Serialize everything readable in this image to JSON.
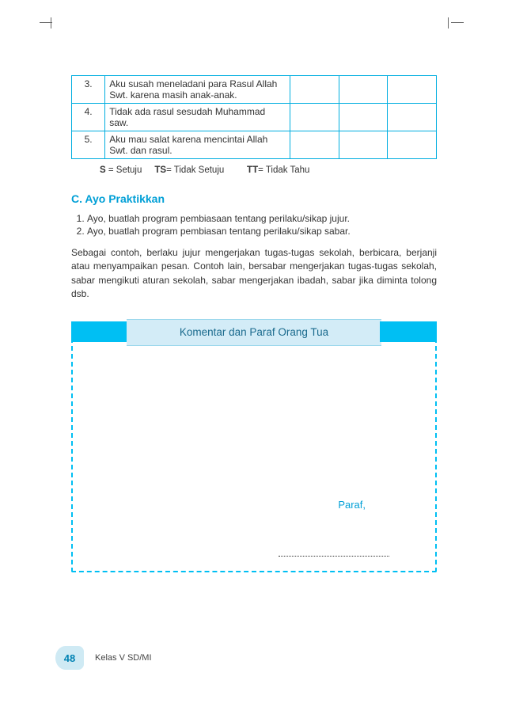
{
  "table": {
    "rows": [
      {
        "num": "3.",
        "text": "Aku susah meneladani para Rasul Allah Swt. karena masih anak-anak."
      },
      {
        "num": "4.",
        "text": "Tidak ada rasul sesudah Muhammad saw."
      },
      {
        "num": "5.",
        "text": "Aku mau salat karena mencintai Allah Swt. dan rasul."
      }
    ]
  },
  "legend": {
    "s_key": "S",
    "s_val": " = Setuju",
    "ts_key": "TS",
    "ts_val": "= Tidak Setuju",
    "tt_key": "TT",
    "tt_val": "= Tidak Tahu"
  },
  "section_c_title": "C. Ayo Praktikkan",
  "instructions": [
    "Ayo, buatlah program pembiasaan tentang perilaku/sikap jujur.",
    "Ayo, buatlah program pembiasan tentang perilaku/sikap sabar."
  ],
  "paragraph": "Sebagai contoh, berlaku jujur mengerjakan tugas-tugas sekolah, berbicara, berjanji atau menyampaikan pesan. Contoh lain, bersabar mengerjakan tugas-tugas sekolah, sabar mengikuti aturan sekolah, sabar mengerjakan ibadah, sabar jika diminta tolong dsb.",
  "comment_box": {
    "header": "Komentar dan Paraf Orang Tua",
    "paraf_label": "Paraf,"
  },
  "footer": {
    "page_number": "48",
    "class_text": "Kelas V SD/MI"
  }
}
